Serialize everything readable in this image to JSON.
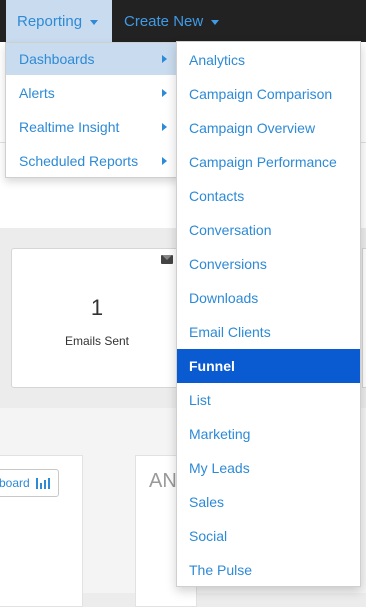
{
  "nav": {
    "reporting_label": "Reporting",
    "create_new_label": "Create New"
  },
  "stat_card": {
    "value": "1",
    "label": "Emails Sent",
    "icon": "envelope-icon"
  },
  "background": {
    "dashboard_button_label": "board",
    "partial_heading": "AN"
  },
  "menu_level1": {
    "items": [
      {
        "label": "Dashboards",
        "active": true
      },
      {
        "label": "Alerts",
        "active": false
      },
      {
        "label": "Realtime Insight",
        "active": false
      },
      {
        "label": "Scheduled Reports",
        "active": false
      }
    ]
  },
  "menu_level2": {
    "items": [
      {
        "label": "Analytics"
      },
      {
        "label": "Campaign Comparison"
      },
      {
        "label": "Campaign Overview"
      },
      {
        "label": "Campaign Performance"
      },
      {
        "label": "Contacts"
      },
      {
        "label": "Conversation"
      },
      {
        "label": "Conversions"
      },
      {
        "label": "Downloads"
      },
      {
        "label": "Email Clients"
      },
      {
        "label": "Funnel",
        "active": true
      },
      {
        "label": "List"
      },
      {
        "label": "Marketing"
      },
      {
        "label": "My Leads"
      },
      {
        "label": "Sales"
      },
      {
        "label": "Social"
      },
      {
        "label": "The Pulse"
      }
    ]
  },
  "colors": {
    "link_blue": "#2d8ad6",
    "highlight_blue": "#0a5bd1",
    "nav_bg": "#222222",
    "active_bg": "#c9dcef"
  }
}
